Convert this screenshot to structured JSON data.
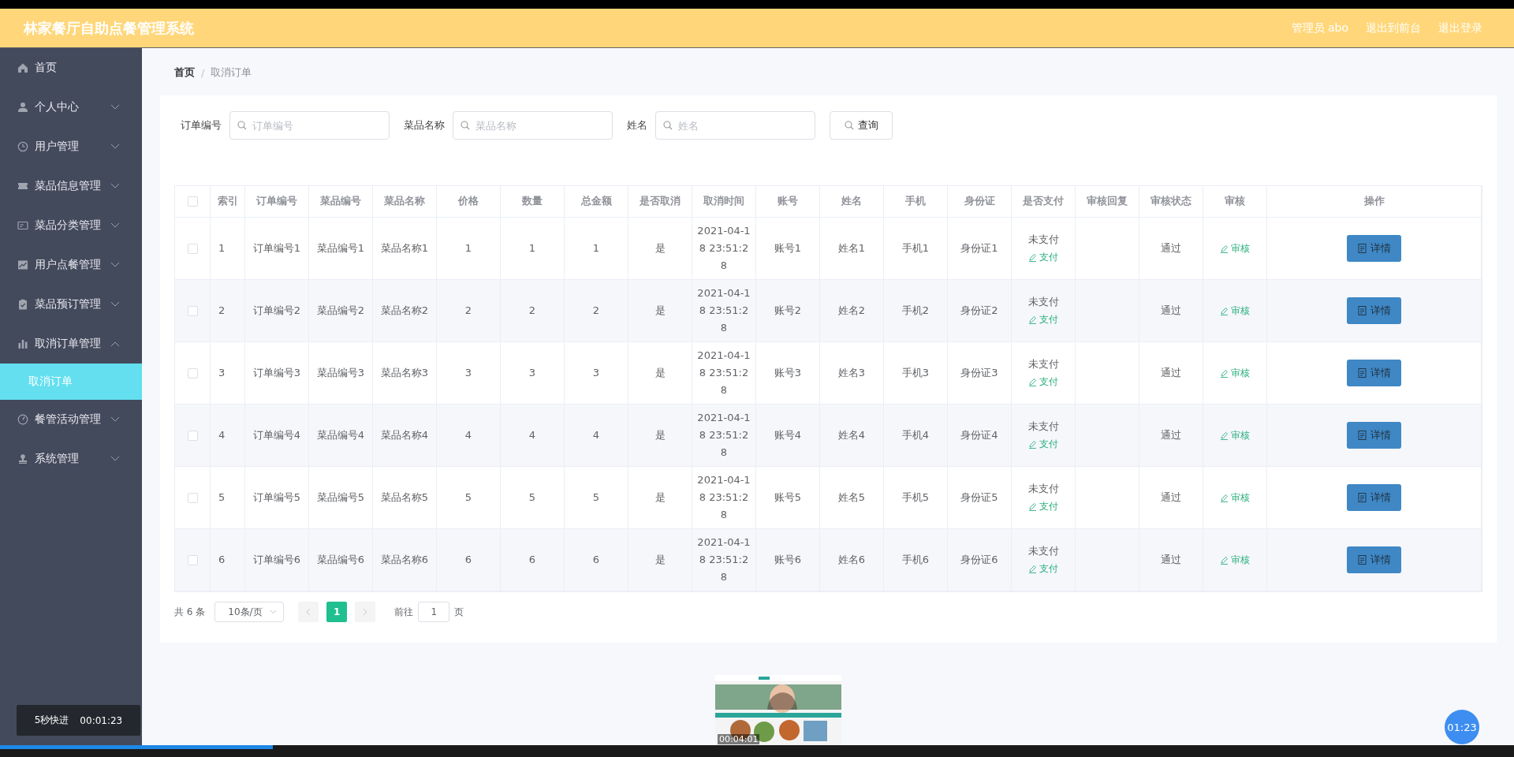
{
  "header": {
    "title": "林家餐厅自助点餐管理系统",
    "links": [
      "管理员 abo",
      "退出到前台",
      "退出登录"
    ]
  },
  "sidebar": {
    "items": [
      {
        "label": "首页",
        "kind": "home"
      },
      {
        "label": "个人中心",
        "kind": "user",
        "expanded": false
      },
      {
        "label": "用户管理",
        "kind": "clock",
        "expanded": false
      },
      {
        "label": "菜品信息管理",
        "kind": "ticket",
        "expanded": false
      },
      {
        "label": "菜品分类管理",
        "kind": "card",
        "expanded": false
      },
      {
        "label": "用户点餐管理",
        "kind": "chart",
        "expanded": false
      },
      {
        "label": "菜品预订管理",
        "kind": "clipboard",
        "expanded": false
      },
      {
        "label": "取消订单管理",
        "kind": "bars",
        "expanded": true,
        "children": [
          {
            "label": "取消订单",
            "selected": true
          }
        ]
      },
      {
        "label": "餐管活动管理",
        "kind": "gauge",
        "expanded": false
      },
      {
        "label": "系统管理",
        "kind": "stamp",
        "expanded": false
      }
    ]
  },
  "breadcrumb": {
    "items": [
      "首页",
      "取消订单"
    ],
    "separator": "/"
  },
  "search": {
    "fields": [
      {
        "label": "订单编号",
        "placeholder": "订单编号"
      },
      {
        "label": "菜品名称",
        "placeholder": "菜品名称"
      },
      {
        "label": "姓名",
        "placeholder": "姓名"
      }
    ],
    "button": "查询"
  },
  "table": {
    "select_all": false,
    "columns": [
      "索引",
      "订单编号",
      "菜品编号",
      "菜品名称",
      "价格",
      "数量",
      "总金额",
      "是否取消",
      "取消时间",
      "账号",
      "姓名",
      "手机",
      "身份证",
      "是否支付",
      "审核回复",
      "审核状态",
      "审核",
      "操作"
    ],
    "rows": [
      {
        "selected": false,
        "cells": [
          "1",
          "订单编号1",
          "菜品编号1",
          "菜品名称1",
          "1",
          "1",
          "1",
          "是",
          "2021-04-18 23:51:28",
          "账号1",
          "姓名1",
          "手机1",
          "身份证1"
        ],
        "payment": "未支付",
        "pay_action": "支付",
        "review_status": "通过",
        "review_action": "审核",
        "detail_button": "详情"
      },
      {
        "selected": false,
        "cells": [
          "2",
          "订单编号2",
          "菜品编号2",
          "菜品名称2",
          "2",
          "2",
          "2",
          "是",
          "2021-04-18 23:51:28",
          "账号2",
          "姓名2",
          "手机2",
          "身份证2"
        ],
        "payment": "未支付",
        "pay_action": "支付",
        "review_status": "通过",
        "review_action": "审核",
        "detail_button": "详情"
      },
      {
        "selected": false,
        "cells": [
          "3",
          "订单编号3",
          "菜品编号3",
          "菜品名称3",
          "3",
          "3",
          "3",
          "是",
          "2021-04-18 23:51:28",
          "账号3",
          "姓名3",
          "手机3",
          "身份证3"
        ],
        "payment": "未支付",
        "pay_action": "支付",
        "review_status": "通过",
        "review_action": "审核",
        "detail_button": "详情"
      },
      {
        "selected": false,
        "cells": [
          "4",
          "订单编号4",
          "菜品编号4",
          "菜品名称4",
          "4",
          "4",
          "4",
          "是",
          "2021-04-18 23:51:28",
          "账号4",
          "姓名4",
          "手机4",
          "身份证4"
        ],
        "payment": "未支付",
        "pay_action": "支付",
        "review_status": "通过",
        "review_action": "审核",
        "detail_button": "详情"
      },
      {
        "selected": false,
        "cells": [
          "5",
          "订单编号5",
          "菜品编号5",
          "菜品名称5",
          "5",
          "5",
          "5",
          "是",
          "2021-04-18 23:51:28",
          "账号5",
          "姓名5",
          "手机5",
          "身份证5"
        ],
        "payment": "未支付",
        "pay_action": "支付",
        "review_status": "通过",
        "review_action": "审核",
        "detail_button": "详情"
      },
      {
        "selected": false,
        "cells": [
          "6",
          "订单编号6",
          "菜品编号6",
          "菜品名称6",
          "6",
          "6",
          "6",
          "是",
          "2021-04-18 23:51:28",
          "账号6",
          "姓名6",
          "手机6",
          "身份证6"
        ],
        "payment": "未支付",
        "pay_action": "支付",
        "review_status": "通过",
        "review_action": "审核",
        "detail_button": "详情"
      }
    ]
  },
  "pagination": {
    "total": "共 6 条",
    "page_size": "10条/页",
    "pages": [
      {
        "label": "1",
        "selected": true
      }
    ],
    "goto_label": "前往",
    "goto_value": "1",
    "page_label": "页"
  },
  "player": {
    "fast_forward": "5秒快进",
    "current_time": "00:01:23",
    "preview_time": "00:04:01",
    "bubble_time": "01:23",
    "progress": {
      "level": 0.18
    }
  }
}
